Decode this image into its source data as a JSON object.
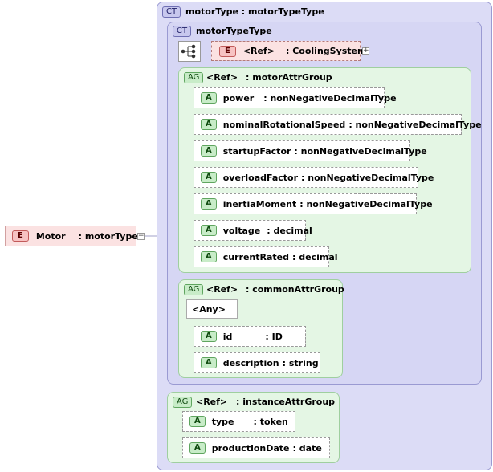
{
  "badges": {
    "ct": "CT",
    "ag": "AG",
    "e": "E",
    "a": "A"
  },
  "root": {
    "name": "Motor",
    "type": ": motorType",
    "toggle": "−"
  },
  "outer_type": {
    "title": "motorType : motorTypeType"
  },
  "inner_type": {
    "title": "motorTypeType"
  },
  "ref_element": {
    "ref": "<Ref>",
    "type": ": CoolingSystem",
    "toggle": "+"
  },
  "groups": [
    {
      "ref": "<Ref>",
      "name": ": motorAttrGroup",
      "attributes": [
        {
          "name": "power",
          "type": ": nonNegativeDecimalType"
        },
        {
          "name": "nominalRotationalSpeed",
          "type": ": nonNegativeDecimalType"
        },
        {
          "name": "startupFactor",
          "type": ": nonNegativeDecimalType"
        },
        {
          "name": "overloadFactor",
          "type": ": nonNegativeDecimalType"
        },
        {
          "name": "inertiaMoment",
          "type": ": nonNegativeDecimalType"
        },
        {
          "name": "voltage",
          "type": ": decimal"
        },
        {
          "name": "currentRated",
          "type": ": decimal"
        }
      ]
    },
    {
      "ref": "<Ref>",
      "name": ": commonAttrGroup",
      "any": "<Any>",
      "attributes": [
        {
          "name": "id",
          "type": ": ID"
        },
        {
          "name": "description",
          "type": ": string"
        }
      ]
    },
    {
      "ref": "<Ref>",
      "name": ": instanceAttrGroup",
      "attributes": [
        {
          "name": "type",
          "type": ": token"
        },
        {
          "name": "productionDate",
          "type": ": date"
        }
      ]
    }
  ]
}
